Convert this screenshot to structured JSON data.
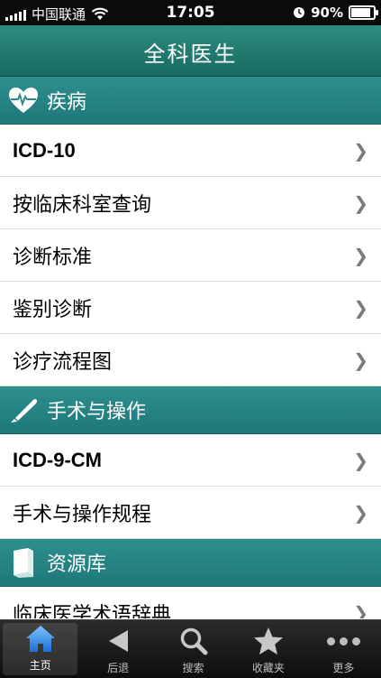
{
  "status": {
    "carrier": "中国联通",
    "time": "17:05",
    "battery": "90%",
    "battery_level": 0.9
  },
  "header": {
    "title": "全科医生"
  },
  "sections": [
    {
      "title": "疾病",
      "icon": "heart-pulse-icon"
    },
    {
      "title": "手术与操作",
      "icon": "scalpel-icon"
    },
    {
      "title": "资源库",
      "icon": "book-icon"
    }
  ],
  "disease_items": [
    {
      "label": "ICD-10"
    },
    {
      "label": "按临床科室查询"
    },
    {
      "label": "诊断标准"
    },
    {
      "label": "鉴别诊断"
    },
    {
      "label": "诊疗流程图"
    }
  ],
  "surgery_items": [
    {
      "label": "ICD-9-CM"
    },
    {
      "label": "手术与操作规程"
    }
  ],
  "resource_items": [
    {
      "label": "临床医学术语辞典"
    }
  ],
  "tabbar": {
    "items": [
      {
        "label": "主页",
        "icon": "home-icon"
      },
      {
        "label": "后退",
        "icon": "back-icon"
      },
      {
        "label": "搜索",
        "icon": "search-icon"
      },
      {
        "label": "收藏夹",
        "icon": "star-icon"
      },
      {
        "label": "更多",
        "icon": "more-icon"
      }
    ],
    "active": "主页"
  },
  "colors": {
    "nav": "#1f7a70",
    "section": "#2a8a8a",
    "chevron": "#7a7a7a"
  }
}
